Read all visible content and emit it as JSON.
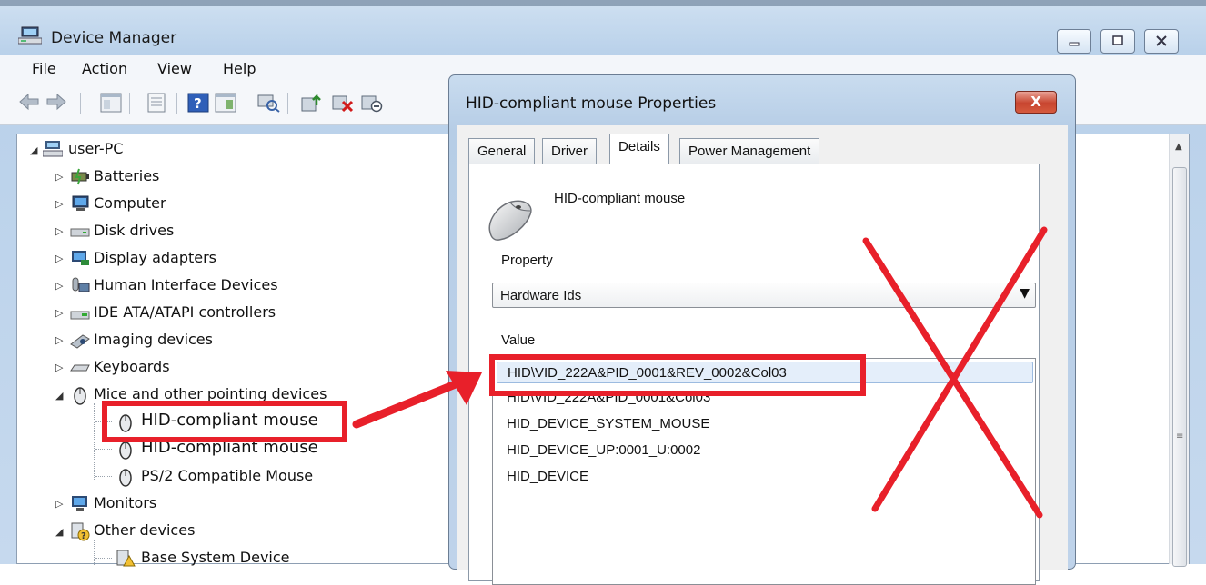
{
  "window": {
    "title": "Device Manager",
    "controls": {
      "minimize": "minimize-icon",
      "maximize": "maximize-icon",
      "close": "close-icon"
    }
  },
  "menu": [
    "File",
    "Action",
    "View",
    "Help"
  ],
  "toolbar_icons": [
    "back-arrow-icon",
    "forward-arrow-icon",
    "console-tree-icon",
    "properties-icon",
    "help-icon",
    "action-pane-icon",
    "scan-hardware-icon",
    "update-driver-icon",
    "uninstall-icon",
    "disable-icon"
  ],
  "tree": {
    "root": "user-PC",
    "categories": [
      {
        "label": "Batteries",
        "icon": "battery-icon"
      },
      {
        "label": "Computer",
        "icon": "computer-icon"
      },
      {
        "label": "Disk drives",
        "icon": "disk-drive-icon"
      },
      {
        "label": "Display adapters",
        "icon": "display-adapter-icon"
      },
      {
        "label": "Human Interface Devices",
        "icon": "hid-icon"
      },
      {
        "label": "IDE ATA/ATAPI controllers",
        "icon": "ide-controller-icon"
      },
      {
        "label": "Imaging devices",
        "icon": "camera-icon"
      },
      {
        "label": "Keyboards",
        "icon": "keyboard-icon"
      }
    ],
    "mice": {
      "label": "Mice and other pointing devices",
      "children": [
        "HID-compliant mouse",
        "HID-compliant mouse",
        "PS/2 Compatible Mouse"
      ]
    },
    "after": [
      {
        "label": "Monitors",
        "icon": "monitor-icon"
      },
      {
        "label": "Other devices",
        "icon": "unknown-device-icon"
      }
    ],
    "other_children": [
      "Base System Device"
    ]
  },
  "dialog": {
    "title": "HID-compliant mouse Properties",
    "close_label": "X",
    "tabs": [
      "General",
      "Driver",
      "Details",
      "Power Management"
    ],
    "active_tab": "Details",
    "device_name": "HID-compliant mouse",
    "property_label": "Property",
    "property_value": "Hardware Ids",
    "value_label": "Value",
    "values": [
      "HID\\VID_222A&PID_0001&REV_0002&Col03",
      "HID\\VID_222A&PID_0001&Col03",
      "HID_DEVICE_SYSTEM_MOUSE",
      "HID_DEVICE_UP:0001_U:0002",
      "HID_DEVICE"
    ]
  },
  "annotation": {
    "color": "#e8202a"
  }
}
